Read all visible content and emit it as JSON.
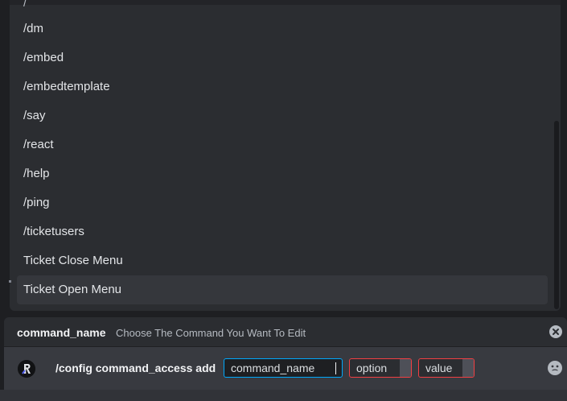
{
  "autocomplete": {
    "partial_item": "/",
    "items": [
      "/dm",
      "/embed",
      "/embedtemplate",
      "/say",
      "/react",
      "/help",
      "/ping",
      "/ticketusers",
      "Ticket Close Menu",
      "Ticket Open Menu"
    ],
    "selected_index": 9
  },
  "option_hint": {
    "name": "command_name",
    "description": "Choose The Command You Want To Edit"
  },
  "input": {
    "command": "/config command_access add",
    "options": [
      "command_name",
      "option",
      "value"
    ]
  },
  "colors": {
    "active_border": "#00a8fc",
    "error_border": "#f23f43",
    "avatar_accent": "#5865f2"
  },
  "icons": {
    "hint_close": "close-circle-icon",
    "avatar": "bot-avatar-icon",
    "emoji": "emoji-icon"
  }
}
